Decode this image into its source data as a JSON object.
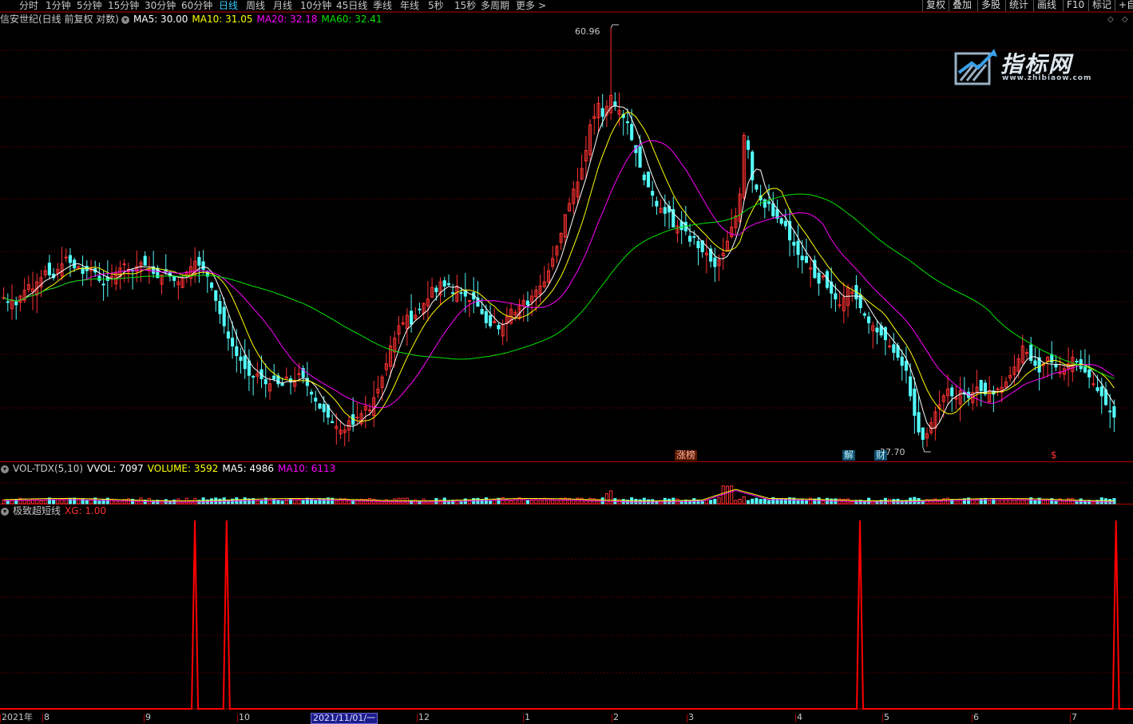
{
  "toolbar": {
    "periods": [
      "分时",
      "1分钟",
      "5分钟",
      "15分钟",
      "30分钟",
      "60分钟",
      "日线",
      "周线",
      "月线",
      "10分钟",
      "45日线",
      "季线",
      "年线",
      "5秒",
      "15秒",
      "多周期",
      "更多"
    ],
    "active_period": "日线",
    "more_arrow": ">",
    "right_buttons": [
      "复权",
      "叠加",
      "多股",
      "统计",
      "画线",
      "F10",
      "标记",
      "+自"
    ]
  },
  "main_panel": {
    "stock_name": "信安世纪(日线 前复权 对数)",
    "ma5_label": "MA5: 30.00",
    "ma10_label": "MA10: 31.05",
    "ma20_label": "MA20: 32.18",
    "ma60_label": "MA60: 32.41",
    "high_label": "60.96",
    "low_label": "27.70",
    "markers": [
      "涨榜",
      "解",
      "财",
      "$"
    ]
  },
  "vol_panel": {
    "name": "VOL-TDX(5,10)",
    "vvol_label": "VVOL: 7097",
    "volume_label": "VOLUME: 3592",
    "ma5_label": "MA5: 4986",
    "ma10_label": "MA10: 6113"
  },
  "indicator_panel": {
    "name": "极致超短线",
    "xg_label": "XG: 1.00"
  },
  "x_axis": {
    "labels": [
      "2021年",
      "8",
      "9",
      "10",
      "12",
      "1",
      "2",
      "3",
      "4",
      "5",
      "6",
      "7"
    ],
    "cursor_date": "2021/11/01/一"
  },
  "watermark": {
    "main": "指标网",
    "sub": "www.zhibiaow.com"
  },
  "colors": {
    "up": "#ff3232",
    "down": "#54fcfc",
    "ma5": "#ffffff",
    "ma10": "#ffff00",
    "ma20": "#ff00ff",
    "ma60": "#00e600",
    "signal": "#ff0000",
    "active_tab": "#33ccff"
  },
  "chart_data": [
    {
      "type": "candlestick",
      "title": "信安世纪(日线 前复权 对数)",
      "scale": "log",
      "ylim": [
        27.7,
        60.96
      ],
      "annotations": [
        {
          "label": "60.96",
          "kind": "high"
        },
        {
          "label": "27.70",
          "kind": "low"
        }
      ],
      "x": [
        "2021年",
        "8",
        "9",
        "10",
        "12",
        "1",
        "2",
        "3",
        "4",
        "5",
        "6",
        "7"
      ],
      "series": [
        {
          "name": "MA5",
          "last": 30.0
        },
        {
          "name": "MA10",
          "last": 31.05
        },
        {
          "name": "MA20",
          "last": 32.18
        },
        {
          "name": "MA60",
          "last": 32.41
        }
      ],
      "close": [
        36.7,
        36.4,
        36.5,
        36.2,
        36.8,
        37.2,
        37.6,
        37.3,
        37.8,
        38.1,
        38.6,
        38.3,
        38.1,
        38.7,
        39.1,
        39.6,
        39.2,
        38.8,
        38.9,
        38.4,
        38.6,
        38.8,
        38.5,
        37.9,
        37.6,
        37.9,
        38.2,
        38.5,
        38.8,
        39.1,
        38.7,
        38.6,
        38.9,
        39.2,
        39.0,
        38.7,
        38.4,
        38.1,
        38.3,
        38.5,
        38.2,
        37.9,
        37.8,
        38.1,
        38.5,
        38.9,
        39.3,
        39.0,
        38.7,
        38.2,
        37.4,
        36.5,
        35.6,
        34.8,
        34.0,
        33.5,
        32.9,
        32.6,
        32.1,
        31.7,
        31.6,
        31.8,
        31.5,
        31.2,
        31.2,
        31.5,
        31.2,
        31.1,
        31.6,
        31.3,
        31.4,
        31.8,
        31.6,
        31.1,
        30.6,
        30.2,
        29.8,
        29.6,
        29.3,
        29.0,
        28.8,
        28.6,
        28.6,
        29.1,
        28.9,
        29.3,
        29.5,
        29.9,
        29.7,
        30.4,
        30.9,
        31.6,
        32.4,
        33.5,
        34.0,
        34.8,
        35.0,
        35.5,
        34.9,
        35.5,
        35.9,
        36.3,
        36.6,
        37.4,
        37.1,
        37.8,
        37.5,
        37.6,
        37.0,
        37.5,
        37.0,
        36.8,
        36.5,
        36.6,
        36.1,
        35.6,
        35.0,
        34.8,
        35.1,
        34.6,
        34.9,
        35.4,
        35.9,
        35.7,
        36.2,
        36.5,
        36.2,
        36.8,
        37.2,
        37.5,
        37.8,
        38.6,
        39.5,
        40.4,
        41.4,
        42.9,
        43.8,
        45.0,
        45.6,
        46.8,
        48.4,
        50.8,
        51.6,
        52.9,
        51.6,
        52.6,
        53.7,
        52.6,
        52.2,
        51.5,
        51.0,
        49.4,
        48.2,
        46.9,
        45.8,
        45.2,
        44.5,
        43.6,
        43.4,
        43.0,
        43.1,
        41.9,
        42.0,
        41.7,
        41.6,
        40.8,
        41.1,
        40.3,
        40.0,
        39.9,
        39.3,
        38.9,
        39.4,
        39.9,
        40.8,
        41.9,
        42.8,
        44.6,
        49.8,
        48.5,
        45.8,
        45.0,
        44.1,
        43.5,
        43.8,
        42.8,
        42.6,
        42.2,
        42.0,
        40.9,
        40.5,
        39.8,
        39.4,
        39.2,
        38.8,
        38.1,
        37.7,
        38.2,
        37.4,
        37.0,
        36.6,
        36.2,
        36.7,
        37.4,
        37.1,
        36.6,
        36.0,
        35.5,
        35.0,
        34.8,
        34.4,
        34.2,
        33.9,
        33.5,
        33.1,
        32.8,
        32.3,
        32.0,
        30.5,
        29.4,
        28.5,
        28.1,
        28.4,
        29.0,
        29.6,
        30.0,
        30.5,
        30.9,
        30.5,
        30.4,
        30.8,
        30.6,
        30.4,
        30.7,
        31.0,
        30.8,
        30.6,
        30.8,
        30.6,
        30.9,
        31.0,
        31.3,
        31.7,
        32.2,
        32.7,
        33.5,
        33.1,
        32.6,
        32.3,
        31.9,
        32.4,
        32.8,
        32.5,
        32.2,
        31.9,
        32.1,
        32.4,
        32.8,
        32.5,
        32.1,
        31.9,
        31.6,
        31.2,
        30.8,
        30.5,
        30.0,
        29.6,
        29.3
      ],
      "volume_note": "volume shown in VOL-TDX panel, values not labeled"
    },
    {
      "type": "line",
      "title": "极致超短线",
      "series": [
        {
          "name": "XG",
          "last": 1.0
        }
      ],
      "signal_positions": [
        0.172,
        0.2,
        0.759,
        0.985
      ],
      "values_on_signal": 1,
      "values_off_signal": 0
    }
  ]
}
